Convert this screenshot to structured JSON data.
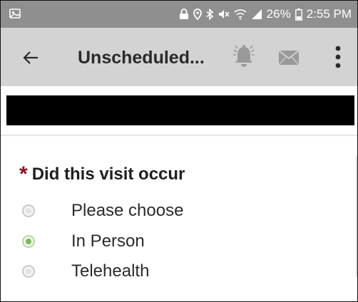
{
  "status_bar": {
    "battery_text": "26%",
    "time": "2:55 PM",
    "icons": [
      "app-icon",
      "lock-icon",
      "location-icon",
      "bluetooth-icon",
      "mute-icon",
      "wifi-icon",
      "signal-icon",
      "battery-icon"
    ]
  },
  "app_bar": {
    "title": "Unscheduled...",
    "icons": [
      "back-arrow-icon",
      "bell-icon",
      "mail-icon",
      "more-vert-icon"
    ]
  },
  "form": {
    "required_marker": "*",
    "question": "Did this visit occur",
    "options": [
      {
        "label": "Please choose",
        "selected": false
      },
      {
        "label": "In Person",
        "selected": true
      },
      {
        "label": "Telehealth",
        "selected": false
      }
    ]
  },
  "colors": {
    "status_bar": "#8f8f8f",
    "app_bar": "#d3d3d3",
    "required": "#8b1420",
    "radio_selected": "#7db65c",
    "redaction": "#000000"
  }
}
